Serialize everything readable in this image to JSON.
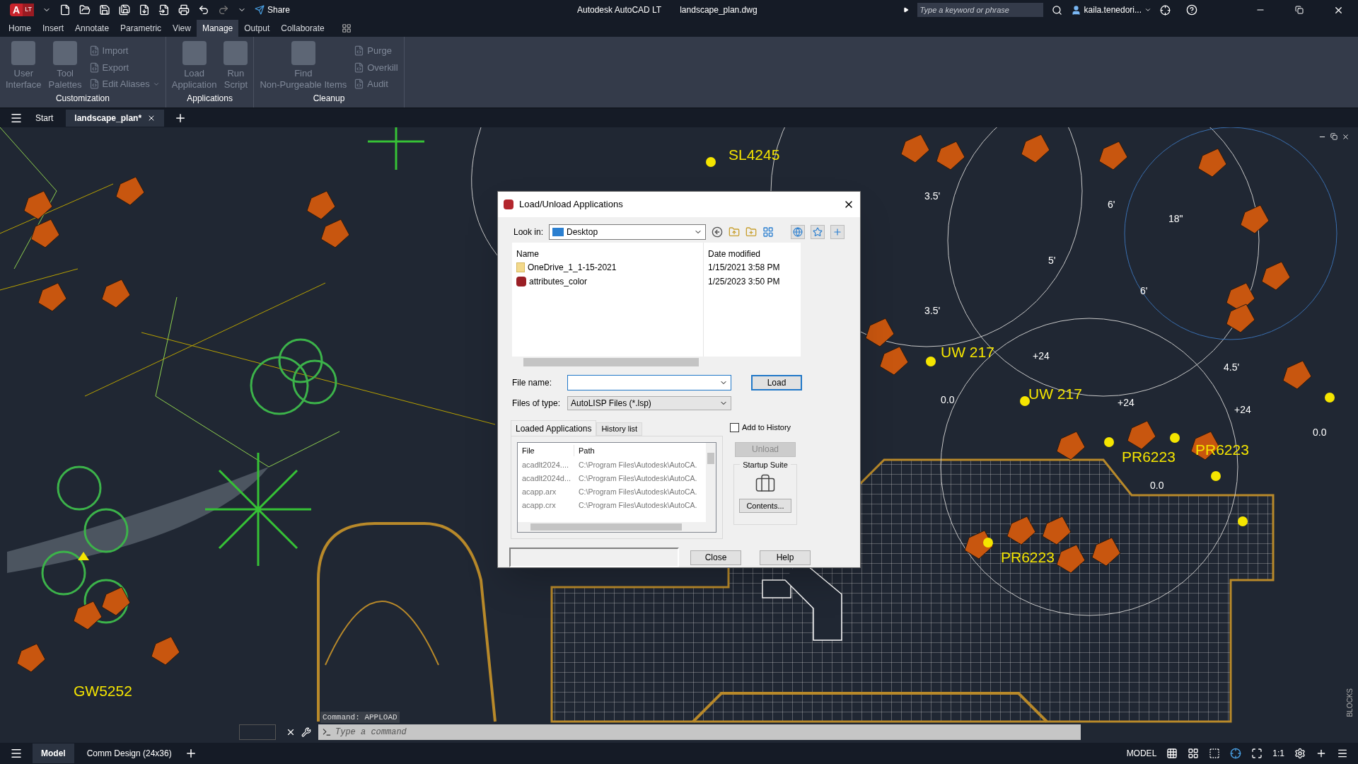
{
  "title_bar": {
    "logo_letter": "A",
    "logo_edition": "LT",
    "share": "Share",
    "app_title": "Autodesk AutoCAD LT",
    "file_title": "landscape_plan.dwg",
    "search_placeholder": "Type a keyword or phrase",
    "user": "kaila.tenedori..."
  },
  "ribbon_tabs": [
    {
      "label": "Home",
      "selected": false
    },
    {
      "label": "Insert",
      "selected": false
    },
    {
      "label": "Annotate",
      "selected": false
    },
    {
      "label": "Parametric",
      "selected": false
    },
    {
      "label": "View",
      "selected": false
    },
    {
      "label": "Manage",
      "selected": true
    },
    {
      "label": "Output",
      "selected": false
    },
    {
      "label": "Collaborate",
      "selected": false
    }
  ],
  "ribbon_panels": [
    {
      "title": "Customization",
      "tools": [
        {
          "kind": "large",
          "label": "User\nInterface"
        },
        {
          "kind": "large",
          "label": "Tool\nPalettes"
        },
        {
          "kind": "stack",
          "items": [
            {
              "label": "Import",
              "menu": false
            },
            {
              "label": "Export",
              "menu": false
            },
            {
              "label": "Edit Aliases",
              "menu": true
            }
          ]
        }
      ]
    },
    {
      "title": "Applications",
      "tools": [
        {
          "kind": "large",
          "label": "Load\nApplication"
        },
        {
          "kind": "large",
          "label": "Run\nScript"
        }
      ]
    },
    {
      "title": "Cleanup",
      "tools": [
        {
          "kind": "large",
          "label": "Find\nNon-Purgeable Items"
        },
        {
          "kind": "stack",
          "items": [
            {
              "label": "Purge",
              "menu": false
            },
            {
              "label": "Overkill",
              "menu": false
            },
            {
              "label": "Audit",
              "menu": false
            }
          ]
        }
      ]
    }
  ],
  "doc_tabs": [
    {
      "label": "Start",
      "selected": false
    },
    {
      "label": "landscape_plan*",
      "selected": true
    }
  ],
  "canvas_labels": [
    {
      "kind": "tag",
      "text": "SL4245"
    },
    {
      "kind": "dim",
      "text": "3.5'"
    },
    {
      "kind": "dim",
      "text": "6'"
    },
    {
      "kind": "dim",
      "text": "18\""
    },
    {
      "kind": "dim",
      "text": "5'"
    },
    {
      "kind": "dim",
      "text": "6'"
    },
    {
      "kind": "dim",
      "text": "3.5'"
    },
    {
      "kind": "tag",
      "text": "UW 217"
    },
    {
      "kind": "dim",
      "text": "+24"
    },
    {
      "kind": "tag",
      "text": "UW 217"
    },
    {
      "kind": "dim",
      "text": "0.0"
    },
    {
      "kind": "dim",
      "text": "+24"
    },
    {
      "kind": "dim",
      "text": "4.5'"
    },
    {
      "kind": "dim",
      "text": "+24"
    },
    {
      "kind": "dim",
      "text": "0.0"
    },
    {
      "kind": "tag",
      "text": "PR6223"
    },
    {
      "kind": "tag",
      "text": "PR6223"
    },
    {
      "kind": "dim",
      "text": "0.0"
    },
    {
      "kind": "tag",
      "text": "PR6223"
    },
    {
      "kind": "tag",
      "text": "GW5252"
    }
  ],
  "dialog": {
    "title": "Load/Unload Applications",
    "look_in_label": "Look in:",
    "look_in_value": "Desktop",
    "file_columns": [
      "Name",
      "Date modified"
    ],
    "files": [
      {
        "kind": "folder",
        "name": "OneDrive_1_1-15-2021",
        "date": "1/15/2021 3:58 PM"
      },
      {
        "kind": "lisp",
        "name": "attributes_color",
        "date": "1/25/2023 3:50 PM"
      }
    ],
    "file_name_label": "File name:",
    "load_button": "Load",
    "file_type_label": "Files of type:",
    "file_type_value": "AutoLISP Files (*.lsp)",
    "tabs": [
      {
        "label": "Loaded Applications",
        "selected": true
      },
      {
        "label": "History list",
        "selected": false
      }
    ],
    "add_to_history": {
      "label": "Add to History",
      "checked": false
    },
    "unload_button": {
      "label": "Unload",
      "disabled": true
    },
    "loaded_columns": [
      "File",
      "Path"
    ],
    "loaded_rows": [
      {
        "file": "acadlt2024....",
        "path": "C:\\Program Files\\Autodesk\\AutoCA."
      },
      {
        "file": "acadlt2024d...",
        "path": "C:\\Program Files\\Autodesk\\AutoCA."
      },
      {
        "file": "acapp.arx",
        "path": "C:\\Program Files\\Autodesk\\AutoCA."
      },
      {
        "file": "acapp.crx",
        "path": "C:\\Program Files\\Autodesk\\AutoCA."
      }
    ],
    "startup_suite": "Startup Suite",
    "contents_button": "Contents...",
    "close_button": "Close",
    "help_button": "Help"
  },
  "command_line": {
    "history": "Command: APPLOAD",
    "placeholder": "Type a command"
  },
  "side_label": "BLOCKS",
  "layout_tabs": [
    {
      "label": "Model",
      "selected": true
    },
    {
      "label": "Comm Design (24x36)",
      "selected": false
    }
  ],
  "status_bar": {
    "model": "MODEL",
    "scale": "1:1"
  }
}
